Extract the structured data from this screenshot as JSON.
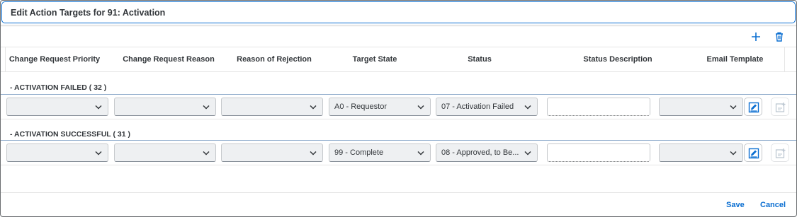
{
  "dialog": {
    "title": "Edit Action Targets for 91: Activation"
  },
  "toolbar": {
    "add_icon": "plus-icon",
    "delete_icon": "trash-icon"
  },
  "table": {
    "columns": [
      "Change Request Priority",
      "Change Request Reason",
      "Reason of Rejection",
      "Target State",
      "Status",
      "Status Description",
      "Email Template"
    ],
    "groups": [
      {
        "title": "- ACTIVATION FAILED ( 32 )",
        "row": {
          "priority": "",
          "reason": "",
          "rejection": "",
          "target_state": "A0 - Requestor",
          "status": "07 - Activation Failed",
          "status_description": "",
          "email_template": ""
        }
      },
      {
        "title": "- ACTIVATION SUCCESSFUL ( 31 )",
        "row": {
          "priority": "",
          "reason": "",
          "rejection": "",
          "target_state": "99 - Complete",
          "status": "08 - Approved, to Be...",
          "status_description": "",
          "email_template": ""
        }
      }
    ]
  },
  "footer": {
    "save_label": "Save",
    "cancel_label": "Cancel"
  },
  "colors": {
    "accent": "#0a6ed1",
    "field_bg": "#eef0f2",
    "text": "#32363a"
  }
}
